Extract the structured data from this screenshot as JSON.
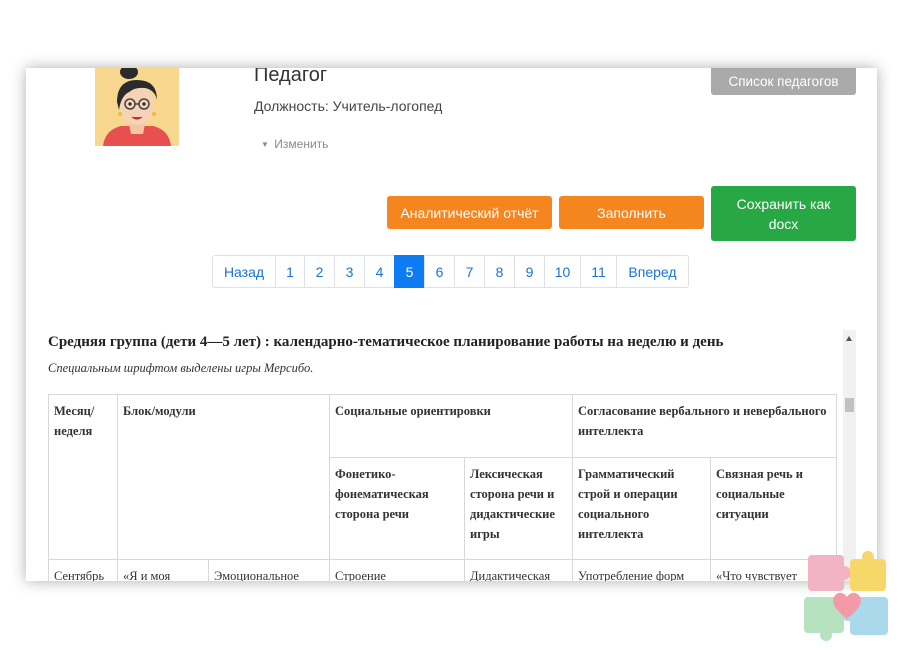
{
  "teacher": {
    "title": "Педагог",
    "position_label": "Должность:",
    "position_value": "Учитель-логопед",
    "edit_label": "Изменить"
  },
  "buttons": {
    "list": "Список педагогов",
    "analytic": "Аналитический отчёт",
    "fill": "Заполнить",
    "docx": "Сохранить как docx"
  },
  "pagination": {
    "prev": "Назад",
    "pages": [
      "1",
      "2",
      "3",
      "4",
      "5",
      "6",
      "7",
      "8",
      "9",
      "10",
      "11"
    ],
    "active": "5",
    "next": "Вперед"
  },
  "document": {
    "title": "Средняя группа (дети 4—5 лет) : календарно-тематическое планирование работы на неделю и день",
    "note": "Специальным шрифтом выделены игры Мерсибо.",
    "header_row1": {
      "month_week": "Месяц/ неделя",
      "block": "Блок/модули",
      "social": "Социальные ориентировки",
      "coordination": "Согласование вербального и невербального интеллекта"
    },
    "header_row2": {
      "phonetic": "Фонетико-фонематическая сторона речи",
      "lexical": "Лексическая сторона речи и дидактические игры",
      "grammar": "Грамматический строй и операции социального интеллекта",
      "coherent": "Связная речь и социальные ситуации"
    },
    "first_row": [
      "Сентябрь",
      "«Я и моя",
      "Эмоциональное",
      "Строение",
      "Дидактическая",
      "Употребление форм",
      "«Что чувствует"
    ]
  },
  "colors": {
    "orange": "#f5861f",
    "green": "#28a745",
    "gray": "#aaaaaa",
    "primary": "#0d7cf2"
  }
}
